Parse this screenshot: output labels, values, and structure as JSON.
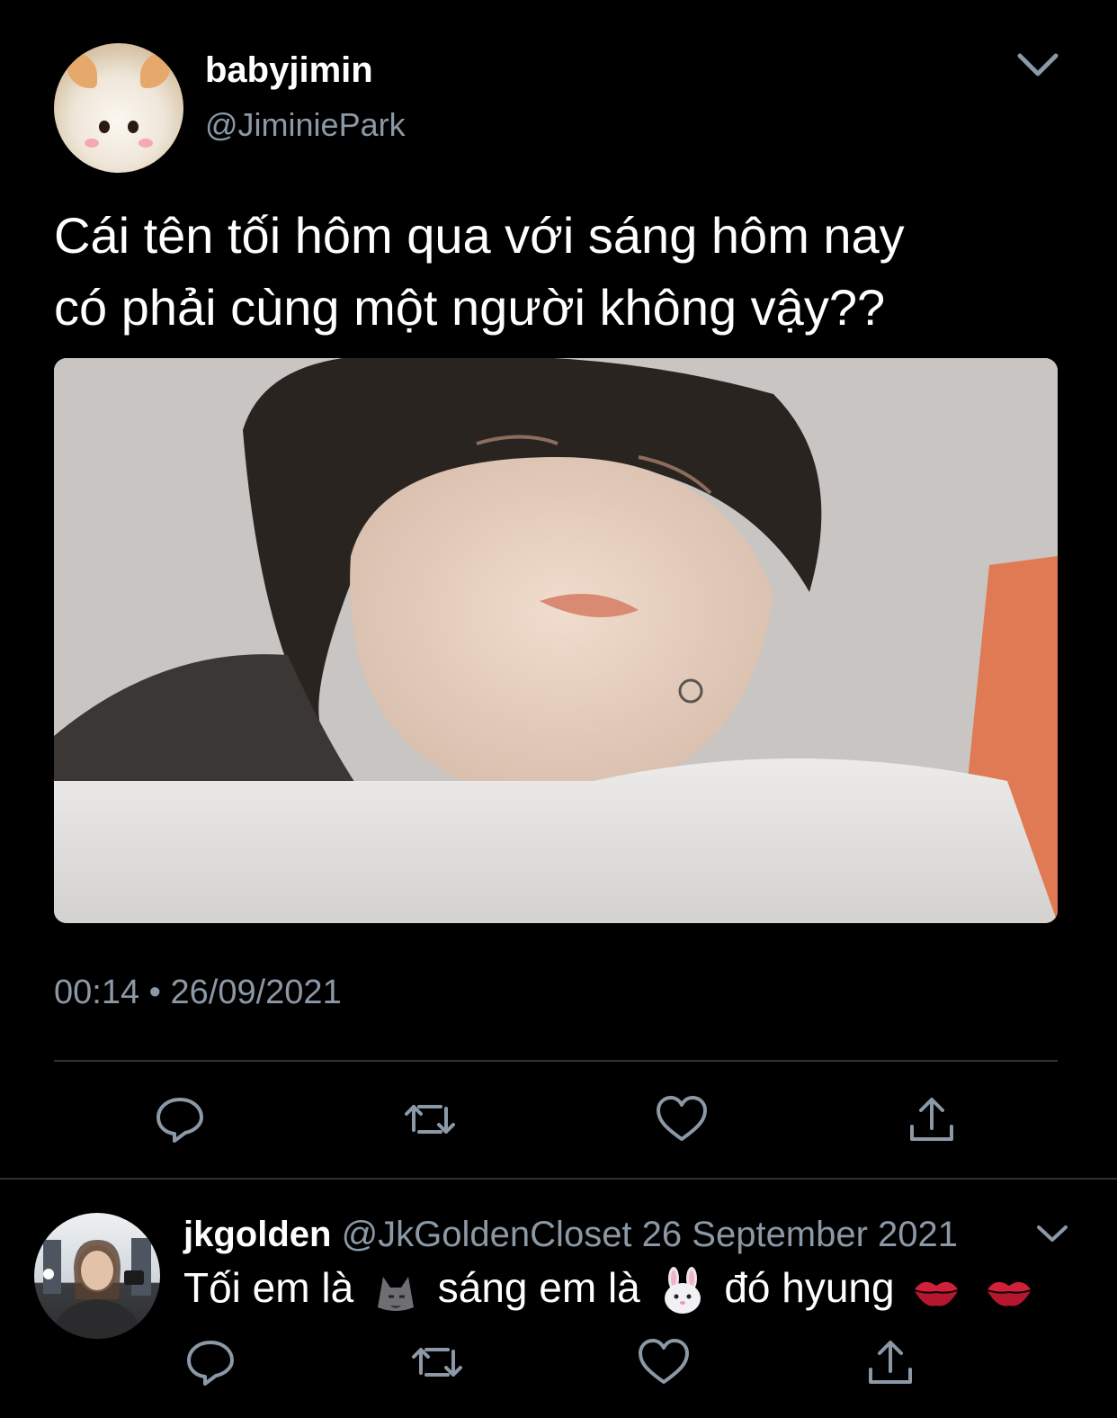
{
  "tweet": {
    "display_name": "babyjimin",
    "handle": "@JiminiePark",
    "text_lines": [
      "Cái tên tối hôm qua với sáng hôm nay",
      "có phải cùng một người không vậy??"
    ],
    "timestamp": "00:14 • 26/09/2021",
    "actions": [
      "reply-icon",
      "retweet-icon",
      "like-icon",
      "share-icon"
    ]
  },
  "reply": {
    "display_name": "jkgolden",
    "handle": "@JkGoldenCloset",
    "date": "26 September 2021",
    "text_parts": [
      "Tối em là",
      "sáng em là",
      "đó hyung"
    ],
    "emojis": [
      "wolf-emoji",
      "rabbit-emoji",
      "kiss-mark-emoji",
      "kiss-mark-emoji"
    ],
    "actions": [
      "reply-icon",
      "retweet-icon",
      "like-icon",
      "share-icon"
    ]
  },
  "colors": {
    "background": "#000000",
    "secondary_text": "#8b98a5",
    "divider": "#2f3336",
    "icon": "#8b98a5"
  }
}
